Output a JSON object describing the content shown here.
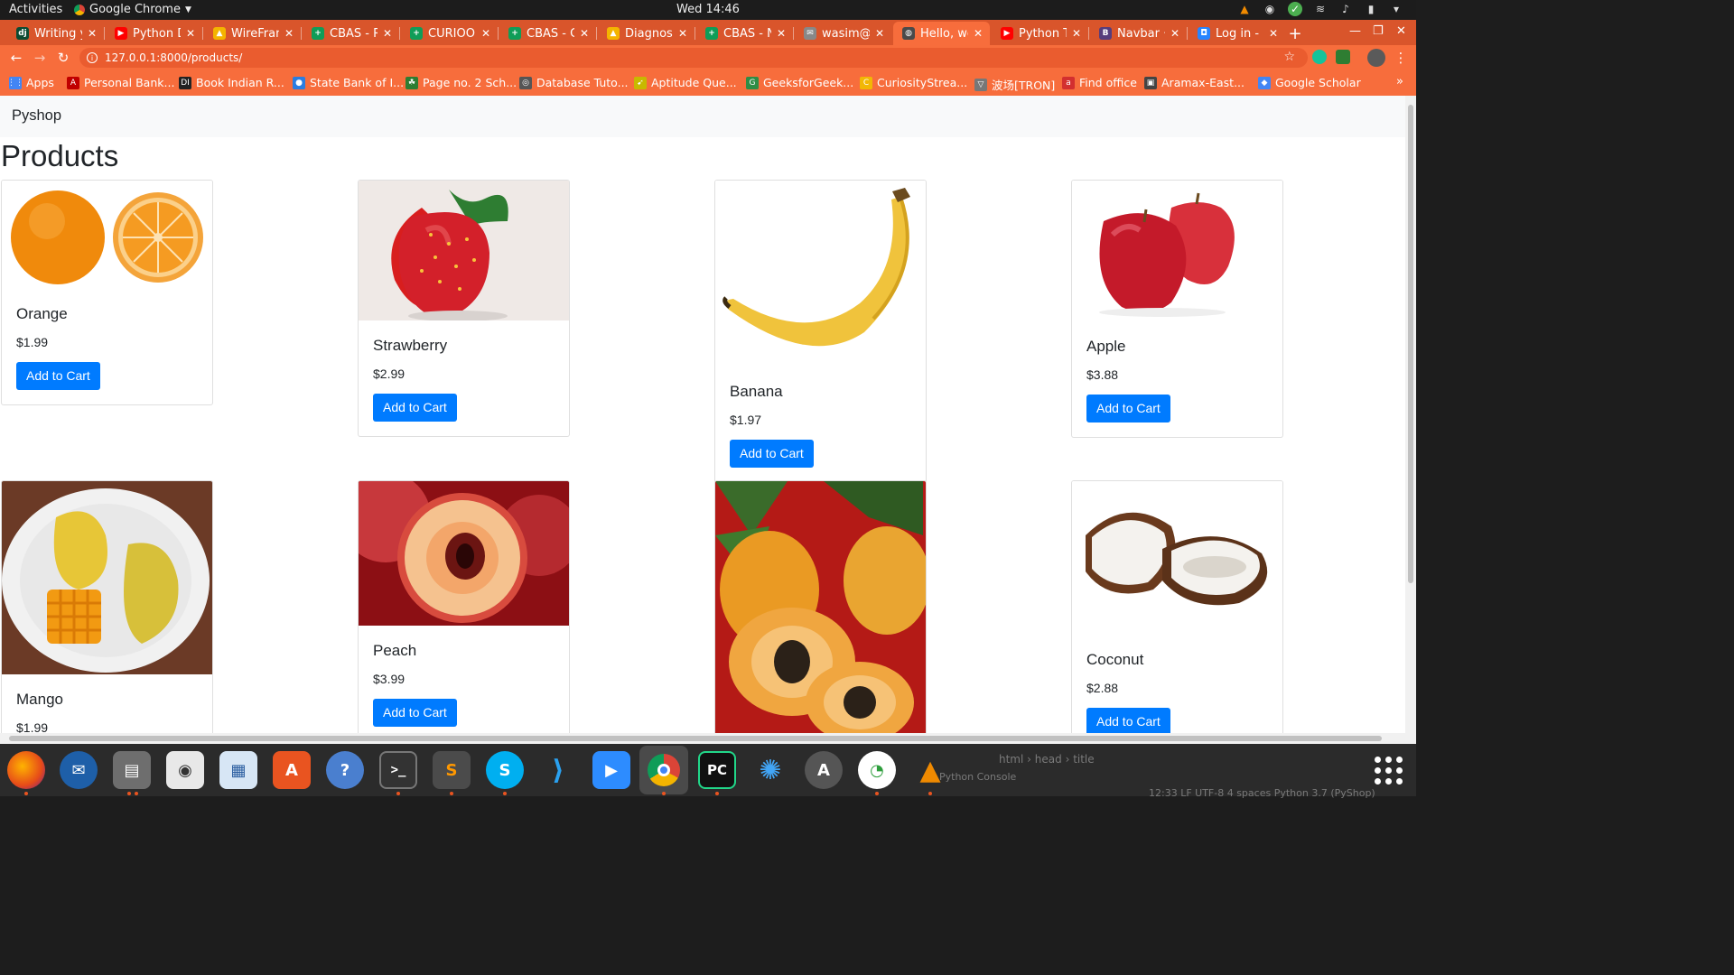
{
  "system": {
    "activities": "Activities",
    "app_name": "Google Chrome",
    "clock": "Wed 14:46"
  },
  "tabs": [
    {
      "title": "Writing yo",
      "color": "#0c4b33",
      "glyph": "dj"
    },
    {
      "title": "Python Dj",
      "color": "#ff0000",
      "glyph": "▶"
    },
    {
      "title": "WireFram",
      "color": "#f4b400",
      "glyph": "▲"
    },
    {
      "title": "CBAS - Ro",
      "color": "#0f9d58",
      "glyph": "+"
    },
    {
      "title": "CURIOO F",
      "color": "#0f9d58",
      "glyph": "+"
    },
    {
      "title": "CBAS - Go",
      "color": "#0f9d58",
      "glyph": "+"
    },
    {
      "title": "Diagnosti",
      "color": "#f4b400",
      "glyph": "▲"
    },
    {
      "title": "CBAS - No",
      "color": "#0f9d58",
      "glyph": "+"
    },
    {
      "title": "wasim@sc",
      "color": "#888888",
      "glyph": "✉"
    },
    {
      "title": "Hello, wor",
      "color": "#4a4a4a",
      "glyph": "◍",
      "active": true
    },
    {
      "title": "Python Tu",
      "color": "#ff0000",
      "glyph": "▶"
    },
    {
      "title": "Navbar · E",
      "color": "#563d7c",
      "glyph": "B"
    },
    {
      "title": "Log in - Bl",
      "color": "#2684ff",
      "glyph": "◘"
    }
  ],
  "address": {
    "url": "127.0.0.1:8000/products/"
  },
  "bookmarks": [
    {
      "label": "Apps",
      "color": "#4285f4",
      "glyph": "⋮⋮"
    },
    {
      "label": "Personal Bank...",
      "color": "#c00000",
      "glyph": "A"
    },
    {
      "label": "Book Indian R...",
      "color": "#222222",
      "glyph": "DI"
    },
    {
      "label": "State Bank of I...",
      "color": "#2a7de1",
      "glyph": "●"
    },
    {
      "label": "Page no. 2 Sch...",
      "color": "#2e7d32",
      "glyph": "☘"
    },
    {
      "label": "Database Tuto...",
      "color": "#555555",
      "glyph": "◎"
    },
    {
      "label": "Aptitude Que...",
      "color": "#c8b900",
      "glyph": "➹"
    },
    {
      "label": "GeeksforGeek...",
      "color": "#2f8d46",
      "glyph": "G"
    },
    {
      "label": "CuriosityStrea...",
      "color": "#f2b705",
      "glyph": "C"
    },
    {
      "label": "波场[TRON]",
      "color": "#777777",
      "glyph": "▽"
    },
    {
      "label": "Find office",
      "color": "#d32f2f",
      "glyph": "a"
    },
    {
      "label": "Aramax-East...",
      "color": "#444444",
      "glyph": "▣"
    },
    {
      "label": "Google Scholar",
      "color": "#4285f4",
      "glyph": "◆"
    }
  ],
  "page": {
    "brand": "Pyshop",
    "heading": "Products",
    "button_label": "Add to Cart",
    "products": [
      {
        "name": "Orange",
        "price": "$1.99",
        "image": "orange"
      },
      {
        "name": "Strawberry",
        "price": "$2.99",
        "image": "strawberry"
      },
      {
        "name": "Banana",
        "price": "$1.97",
        "image": "banana"
      },
      {
        "name": "Apple",
        "price": "$3.88",
        "image": "apple"
      },
      {
        "name": "Mango",
        "price": "$1.99",
        "image": "mango"
      },
      {
        "name": "Peach",
        "price": "$3.99",
        "image": "peach"
      },
      {
        "name": "",
        "price": "",
        "image": "papaya"
      },
      {
        "name": "Coconut",
        "price": "$2.88",
        "image": "coconut"
      }
    ]
  },
  "ide_background": {
    "breadcrumbs": [
      "html",
      "head",
      "title"
    ],
    "panel": "Python Console",
    "status": "12:33   LF   UTF-8   4 spaces   Python 3.7 (PyShop)"
  },
  "colors": {
    "primary_button": "#007bff",
    "chrome_theme": "#f76d3c",
    "navbar_bg": "#f8f9fa"
  }
}
